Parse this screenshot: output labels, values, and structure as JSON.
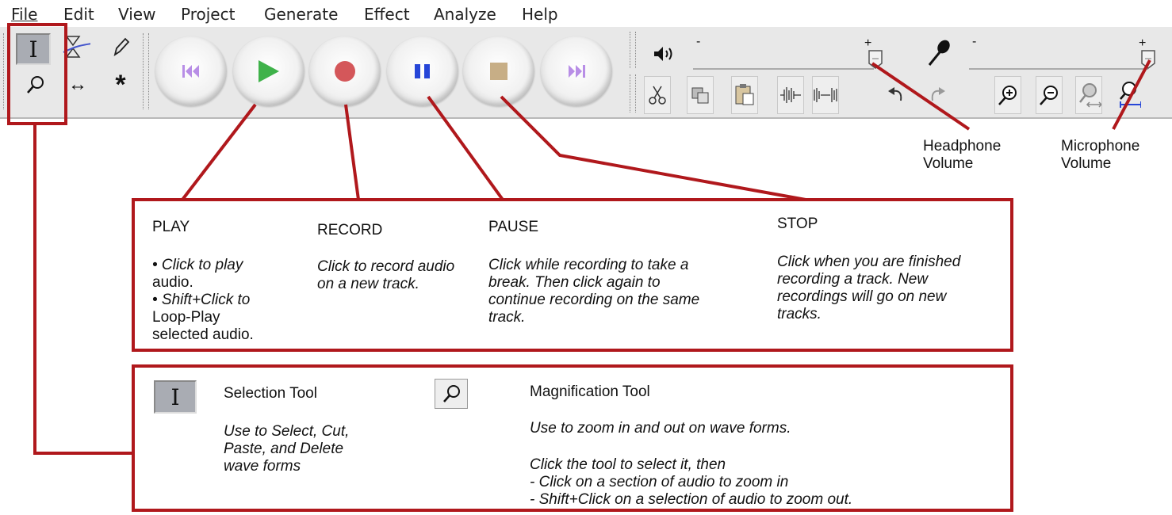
{
  "menu": [
    "File",
    "Edit",
    "View",
    "Project",
    "Generate",
    "Effect",
    "Analyze",
    "Help"
  ],
  "tools": {
    "selection": "selection-tool",
    "envelope": "envelope-tool",
    "draw": "draw-tool",
    "zoom": "zoom-tool",
    "timeshift": "timeshift-tool",
    "multi": "multi-tool"
  },
  "transport": [
    "skip-to-start",
    "play",
    "record",
    "pause",
    "stop",
    "skip-to-end"
  ],
  "meters": {
    "headphone": {
      "minus": "-",
      "plus": "+"
    },
    "microphone": {
      "minus": "-",
      "plus": "+"
    }
  },
  "callouts": {
    "headphone_volume": [
      "Headphone",
      "Volume"
    ],
    "microphone_volume": [
      "Microphone",
      "Volume"
    ]
  },
  "panel1": {
    "play": {
      "title": "PLAY",
      "line1": "• Click to play",
      "line2": "audio.",
      "line3": "• Shift+Click to",
      "line4": "Loop-Play",
      "line5": "selected audio."
    },
    "record": {
      "title": "RECORD",
      "line1": "Click to record audio",
      "line2": "on a new track."
    },
    "pause": {
      "title": "PAUSE",
      "line1": "Click while recording to take a",
      "line2": "break. Then click again to",
      "line3": "continue recording on the same",
      "line4": "track."
    },
    "stop": {
      "title": "STOP",
      "line1": "Click when you are finished",
      "line2": "recording a track. New",
      "line3": "recordings will go on new",
      "line4": "tracks."
    }
  },
  "panel2": {
    "selection": {
      "title": "Selection Tool",
      "line1": "Use to Select, Cut,",
      "line2": "Paste, and Delete",
      "line3": "wave forms"
    },
    "magnification": {
      "title": "Magnification Tool",
      "line1": "Use to zoom in and out on wave forms.",
      "line2": "Click the tool to select it, then",
      "line3": "- Click on a section of audio to zoom in",
      "line4": "- Shift+Click on a selection of audio to zoom out."
    }
  },
  "colors": {
    "annotation_red": "#b0181c",
    "play_green": "#3fb24a",
    "record_red": "#d4575a",
    "pause_blue": "#2646d8",
    "stop_tan": "#c7ae86",
    "skip_purple": "#b88ee6"
  }
}
